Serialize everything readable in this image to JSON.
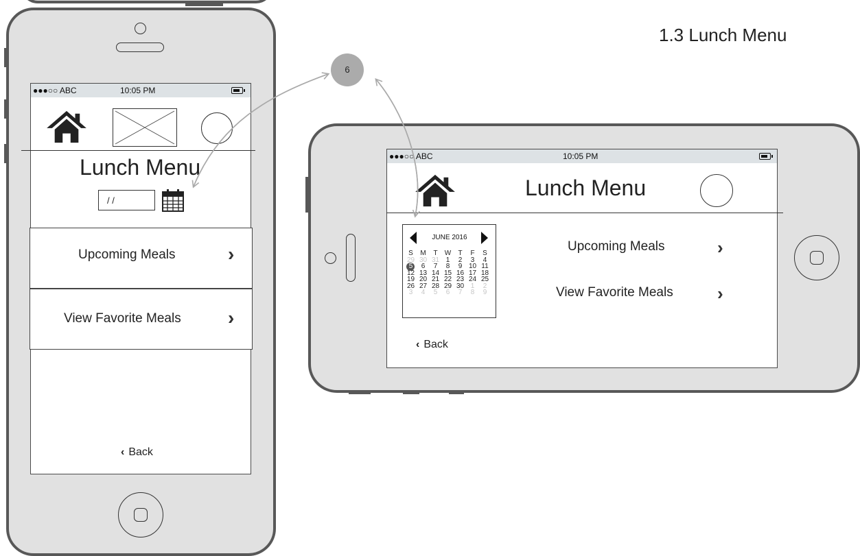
{
  "page": {
    "heading": "1.3 Lunch Menu"
  },
  "annotation": {
    "badge": "6"
  },
  "portrait": {
    "status": {
      "carrier": "●●●○○ ABC",
      "time": "10:05 PM"
    },
    "title": "Lunch Menu",
    "date_field": {
      "value": "/ /"
    },
    "menu": [
      {
        "label": "Upcoming Meals",
        "chevron": "›"
      },
      {
        "label": "View Favorite Meals",
        "chevron": "›"
      }
    ],
    "back": {
      "glyph": "‹",
      "label": "Back"
    }
  },
  "landscape": {
    "status": {
      "carrier": "●●●○○ ABC",
      "time": "10:05 PM"
    },
    "title": "Lunch Menu",
    "calendar": {
      "month": "JUNE 2016",
      "weekdays": [
        "S",
        "M",
        "T",
        "W",
        "T",
        "F",
        "S"
      ],
      "selected": "5",
      "rows": [
        [
          "29",
          "30",
          "31",
          "1",
          "2",
          "3",
          "4"
        ],
        [
          "5",
          "6",
          "7",
          "8",
          "9",
          "10",
          "11"
        ],
        [
          "12",
          "13",
          "14",
          "15",
          "16",
          "17",
          "18"
        ],
        [
          "19",
          "20",
          "21",
          "22",
          "23",
          "24",
          "25"
        ],
        [
          "26",
          "27",
          "28",
          "29",
          "30",
          "1",
          "2"
        ],
        [
          "3",
          "4",
          "5",
          "6",
          "7",
          "8",
          "9"
        ]
      ]
    },
    "menu": [
      {
        "label": "Upcoming Meals",
        "chevron": "›"
      },
      {
        "label": "View Favorite Meals",
        "chevron": "›"
      }
    ],
    "back": {
      "glyph": "‹",
      "label": "Back"
    }
  },
  "colors": {
    "phone_body": "#e1e1e1",
    "phone_border": "#585858",
    "status_bar": "#dde2e5",
    "badge": "#ababab"
  },
  "icons": {
    "home": "home-icon",
    "avatar": "circle-avatar-icon",
    "calendar": "calendar-icon",
    "image_placeholder": "image-placeholder-icon",
    "chevron": "chevron-right-icon"
  }
}
